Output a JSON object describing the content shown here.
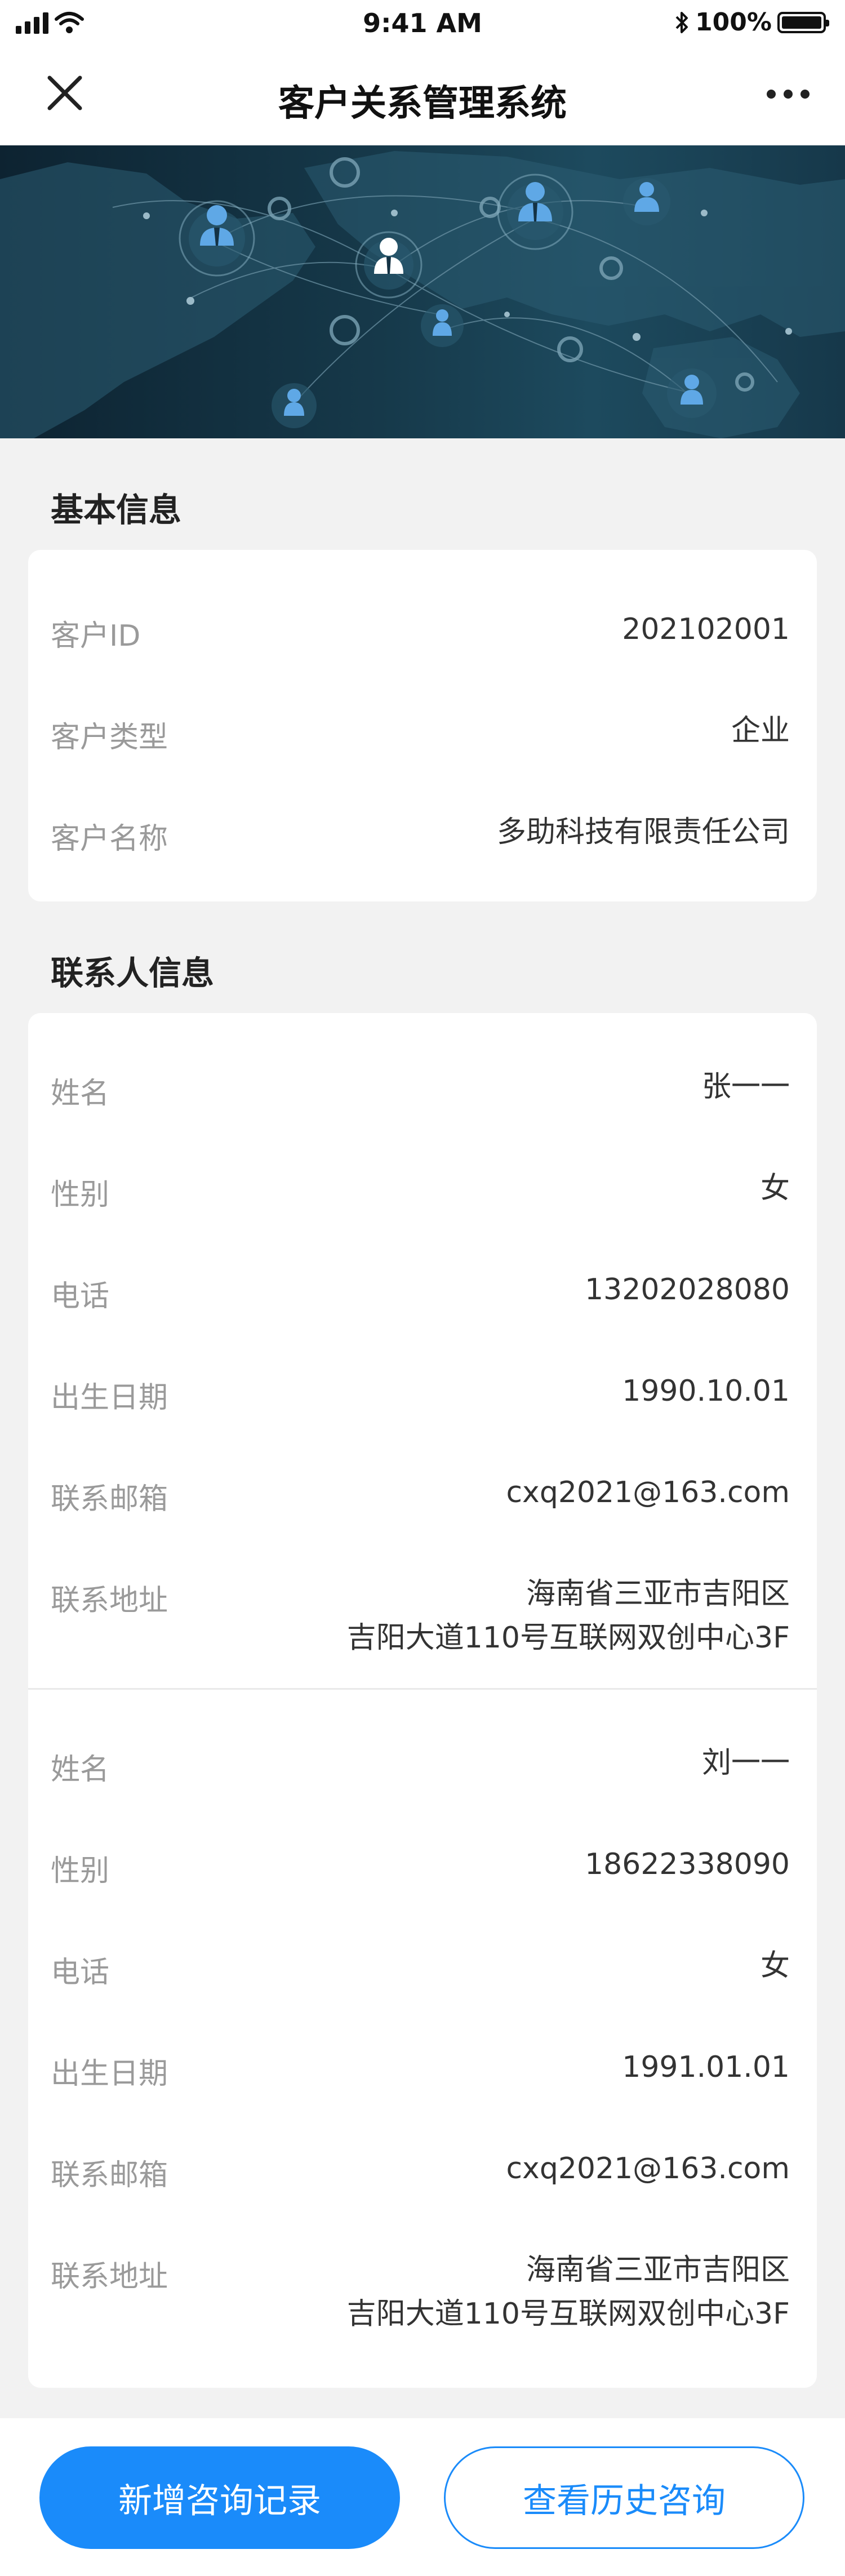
{
  "status_bar": {
    "time": "9:41 AM",
    "battery": "100%"
  },
  "nav": {
    "title": "客户关系管理系统"
  },
  "basic_info": {
    "title": "基本信息",
    "rows": [
      {
        "label": "客户ID",
        "value": "202102001"
      },
      {
        "label": "客户类型",
        "value": "企业"
      },
      {
        "label": "客户名称",
        "value": "多助科技有限责任公司"
      }
    ]
  },
  "contacts": {
    "title": "联系人信息",
    "items": [
      {
        "rows": [
          {
            "label": "姓名",
            "value": "张一一"
          },
          {
            "label": "性别",
            "value": "女"
          },
          {
            "label": "电话",
            "value": "13202028080"
          },
          {
            "label": "出生日期",
            "value": "1990.10.01"
          },
          {
            "label": "联系邮箱",
            "value": "cxq2021@163.com"
          },
          {
            "label": "联系地址",
            "value_line1": "海南省三亚市吉阳区",
            "value_line2": "吉阳大道110号互联网双创中心3F"
          }
        ]
      },
      {
        "rows": [
          {
            "label": "姓名",
            "value": "刘一一"
          },
          {
            "label": "性别",
            "value": "18622338090"
          },
          {
            "label": "电话",
            "value": "女"
          },
          {
            "label": "出生日期",
            "value": "1991.01.01"
          },
          {
            "label": "联系邮箱",
            "value": "cxq2021@163.com"
          },
          {
            "label": "联系地址",
            "value_line1": "海南省三亚市吉阳区",
            "value_line2": "吉阳大道110号互联网双创中心3F"
          }
        ]
      }
    ]
  },
  "actions": {
    "primary": "新增咨询记录",
    "secondary": "查看历史咨询"
  },
  "colors": {
    "accent": "#1a8bfa",
    "page_bg": "#f2f2f2",
    "label": "#9a9a9a"
  },
  "icons": [
    "signal-icon",
    "wifi-icon",
    "bluetooth-icon",
    "battery-icon",
    "close-icon",
    "more-icon"
  ]
}
